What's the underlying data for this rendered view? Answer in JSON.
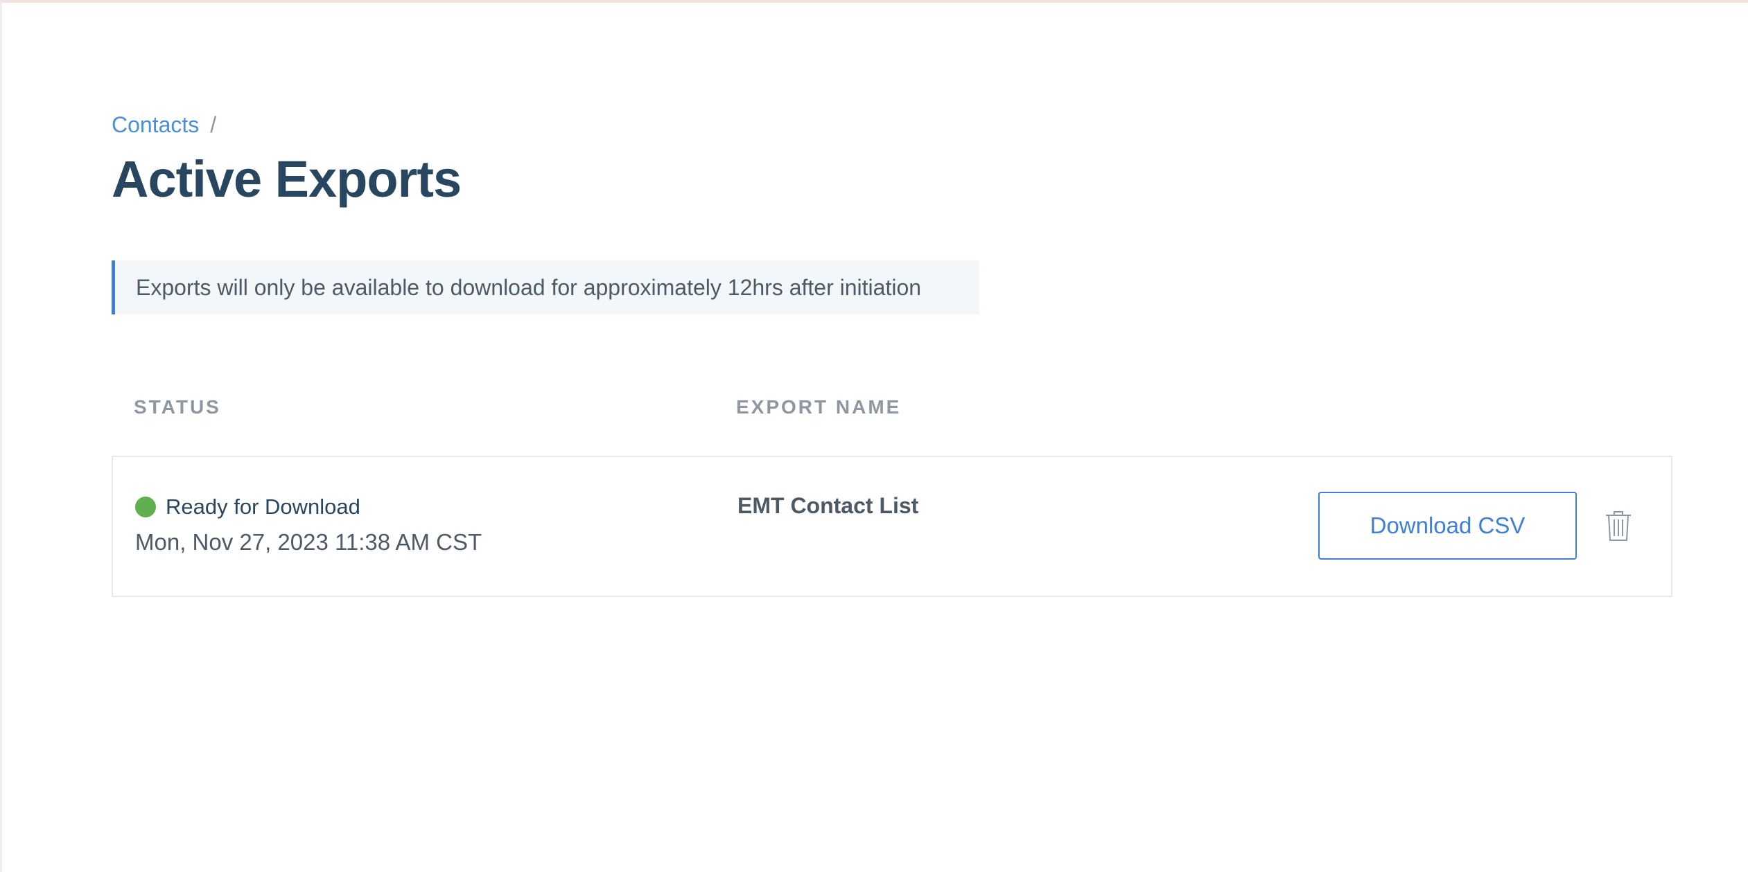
{
  "breadcrumb": {
    "parent_label": "Contacts",
    "separator": "/"
  },
  "page": {
    "title": "Active Exports"
  },
  "notice": {
    "text": "Exports will only be available to download for approximately 12hrs after initiation"
  },
  "table": {
    "columns": {
      "status": "STATUS",
      "export_name": "EXPORT NAME"
    },
    "rows": [
      {
        "status_label": "Ready for Download",
        "status_color": "#5faf4e",
        "timestamp": "Mon, Nov 27, 2023 11:38 AM CST",
        "export_name": "EMT Contact List",
        "download_label": "Download CSV",
        "delete_icon": "trash-icon"
      }
    ]
  },
  "colors": {
    "accent": "#3e7fd8",
    "link": "#4a90d9",
    "title": "#294661",
    "muted": "#8c97a3"
  }
}
